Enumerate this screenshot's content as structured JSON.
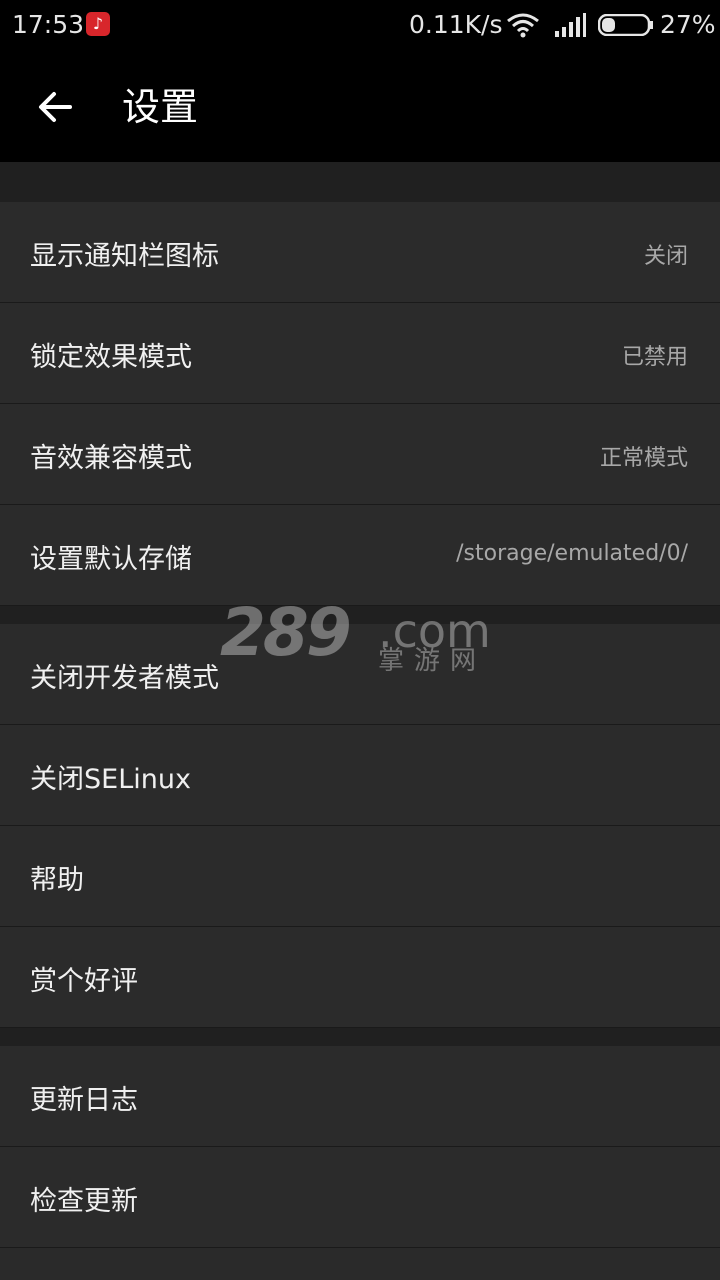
{
  "status_bar": {
    "time": "17:53",
    "net_speed": "0.11K/s",
    "battery": "27%"
  },
  "header": {
    "title": "设置"
  },
  "watermark": {
    "brand": "289",
    "domain": ".com",
    "cn": "掌游网"
  },
  "sections": [
    {
      "items": [
        {
          "label": "显示通知栏图标",
          "value": "关闭"
        },
        {
          "label": "锁定效果模式",
          "value": "已禁用"
        },
        {
          "label": "音效兼容模式",
          "value": "正常模式"
        },
        {
          "label": "设置默认存储",
          "value": "/storage/emulated/0/"
        }
      ]
    },
    {
      "items": [
        {
          "label": "关闭开发者模式"
        },
        {
          "label": "关闭SELinux"
        },
        {
          "label": "帮助"
        },
        {
          "label": "赏个好评"
        }
      ]
    },
    {
      "items": [
        {
          "label": "更新日志"
        },
        {
          "label": "检查更新"
        }
      ]
    }
  ]
}
